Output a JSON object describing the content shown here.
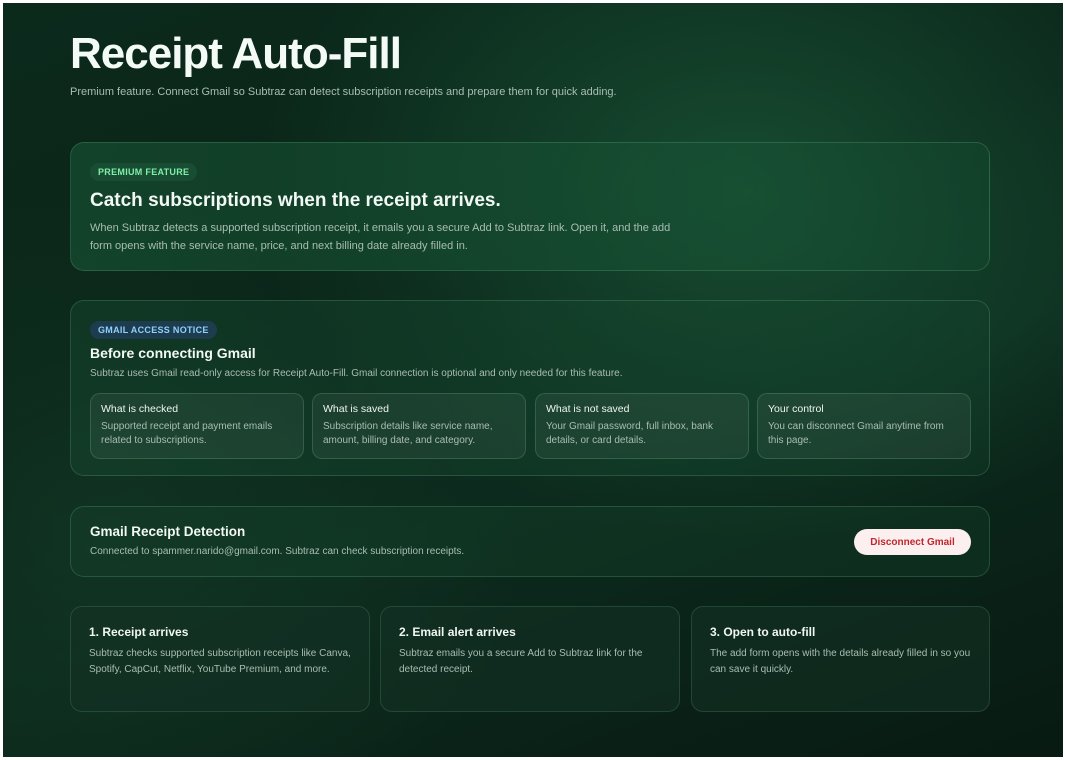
{
  "page": {
    "title": "Receipt Auto-Fill",
    "subtitle": "Premium feature. Connect Gmail so Subtraz can detect subscription receipts and prepare them for quick adding."
  },
  "premium": {
    "badge": "PREMIUM FEATURE",
    "heading": "Catch subscriptions when the receipt arrives.",
    "body": "When Subtraz detects a supported subscription receipt, it emails you a secure Add to Subtraz link. Open it, and the add form opens with the service name, price, and next billing date already filled in."
  },
  "notice": {
    "badge": "GMAIL ACCESS NOTICE",
    "heading": "Before connecting Gmail",
    "body": "Subtraz uses Gmail read-only access for Receipt Auto-Fill. Gmail connection is optional and only needed for this feature.",
    "items": [
      {
        "title": "What is checked",
        "text": "Supported receipt and payment emails related to subscriptions."
      },
      {
        "title": "What is saved",
        "text": "Subscription details like service name, amount, billing date, and category."
      },
      {
        "title": "What is not saved",
        "text": "Your Gmail password, full inbox, bank details, or card details."
      },
      {
        "title": "Your control",
        "text": "You can disconnect Gmail anytime from this page."
      }
    ]
  },
  "detection": {
    "heading": "Gmail Receipt Detection",
    "status": "Connected to spammer.narido@gmail.com. Subtraz can check subscription receipts.",
    "disconnect_label": "Disconnect Gmail"
  },
  "steps": [
    {
      "title": "1. Receipt arrives",
      "text": "Subtraz checks supported subscription receipts like Canva, Spotify, CapCut, Netflix, YouTube Premium, and more."
    },
    {
      "title": "2. Email alert arrives",
      "text": "Subtraz emails you a secure Add to Subtraz link for the detected receipt."
    },
    {
      "title": "3. Open to auto-fill",
      "text": "The add form opens with the details already filled in so you can save it quickly."
    }
  ],
  "colors": {
    "background": "#0a2318",
    "accent_green": "#7ff0a8",
    "accent_blue": "#8fd0ff",
    "danger": "#c0262c"
  }
}
